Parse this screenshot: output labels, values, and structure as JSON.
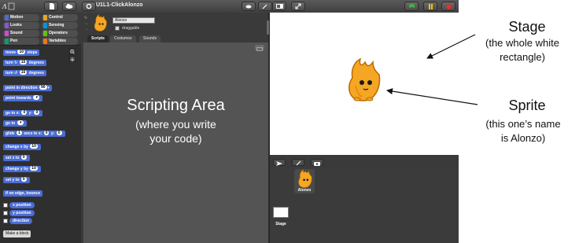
{
  "window": {
    "project_title": "U1L1-ClickAlonzo"
  },
  "palette": {
    "categories": [
      {
        "label": "Motion",
        "color": "#4a6cd4"
      },
      {
        "label": "Control",
        "color": "#e6a822"
      },
      {
        "label": "Looks",
        "color": "#8a55d7"
      },
      {
        "label": "Sensing",
        "color": "#0094dd"
      },
      {
        "label": "Sound",
        "color": "#cf4ad9"
      },
      {
        "label": "Operators",
        "color": "#62c213"
      },
      {
        "label": "Pen",
        "color": "#00a178"
      },
      {
        "label": "Variables",
        "color": "#f3761d"
      }
    ],
    "blocks": {
      "move": {
        "pre": "move",
        "value": "10",
        "post": "steps"
      },
      "turn_cw": {
        "pre": "turn",
        "value": "15",
        "post": "degrees"
      },
      "turn_ccw": {
        "pre": "turn",
        "value": "15",
        "post": "degrees"
      },
      "point_dir": {
        "pre": "point in direction",
        "value": "90"
      },
      "point_towards": {
        "pre": "point towards"
      },
      "goto_xy": {
        "pre": "go to x:",
        "x": "0",
        "mid": "y:",
        "y": "0"
      },
      "goto": {
        "pre": "go to"
      },
      "glide": {
        "pre": "glide",
        "secs": "1",
        "mid1": "secs to x:",
        "x": "0",
        "mid2": "y:",
        "y": "0"
      },
      "change_x": {
        "pre": "change x by",
        "value": "10"
      },
      "set_x": {
        "pre": "set x to",
        "value": "0"
      },
      "change_y": {
        "pre": "change y by",
        "value": "10"
      },
      "set_y": {
        "pre": "set y to",
        "value": "0"
      },
      "bounce": {
        "label": "if on edge, bounce"
      },
      "reporters": [
        "x position",
        "y position",
        "direction"
      ],
      "make_block": "Make a block"
    }
  },
  "sprite": {
    "name": "Alonzo",
    "draggable_label": "draggable",
    "tabs": [
      "Scripts",
      "Costumes",
      "Sounds"
    ]
  },
  "script_area": {
    "title": "Scripting Area",
    "sub1": "(where you write",
    "sub2": "your code)"
  },
  "corral": {
    "sprite_name": "Alonzo",
    "stage_name": "Stage"
  },
  "annotations": {
    "stage_title": "Stage",
    "stage_sub1": "(the whole white",
    "stage_sub2": "rectangle)",
    "sprite_title": "Sprite",
    "sprite_sub1": "(this one’s name",
    "sprite_sub2": "is Alonzo)"
  },
  "colors": {
    "motion_blue": "#4a6cd4",
    "go_green": "#3fb33f",
    "pause_yellow": "#f0c419",
    "stop_red": "#e03030",
    "alonzo_orange": "#f5a623"
  }
}
